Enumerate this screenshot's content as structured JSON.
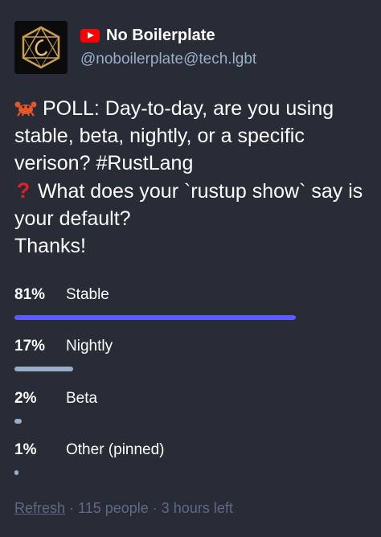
{
  "author": {
    "display_name": "No Boilerplate",
    "handle": "@noboilerplate@tech.lgbt",
    "avatar_icon": "no-boilerplate-logo",
    "badge_icon": "youtube-icon"
  },
  "status": {
    "line1_icon": "crab-icon",
    "line1_text": "POLL: Day-to-day, are you using stable, beta, nightly, or a specific verison? #RustLang",
    "line2_icon": "red-question-mark-icon",
    "line2_text": "What does your `rustup show` say is your default?",
    "line3_text": "Thanks!"
  },
  "poll": {
    "options": [
      {
        "percent": "81%",
        "label": "Stable",
        "value": 81,
        "leading": true
      },
      {
        "percent": "17%",
        "label": "Nightly",
        "value": 17,
        "leading": false
      },
      {
        "percent": "2%",
        "label": "Beta",
        "value": 2,
        "leading": false
      },
      {
        "percent": "1%",
        "label": "Other (pinned)",
        "value": 1,
        "leading": false
      }
    ],
    "refresh_label": "Refresh",
    "separator": " · ",
    "people": "115 people",
    "time_left": "3 hours left",
    "colors": {
      "leading_bar": "#595aff",
      "bar": "#9baec8"
    }
  }
}
